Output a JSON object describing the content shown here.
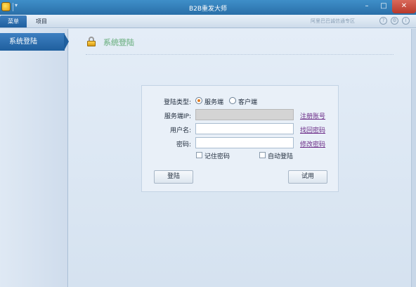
{
  "window": {
    "title": "B2B重发大师",
    "min_label": "–",
    "max_label": "□",
    "close_label": "✕"
  },
  "ribbon": {
    "tabs": [
      {
        "label": "菜单",
        "active": true
      },
      {
        "label": "项目",
        "active": false
      }
    ],
    "right_text": "阿里巴巴诚信通专区"
  },
  "sidebar": {
    "items": [
      {
        "label": "系统登陆",
        "active": true
      }
    ]
  },
  "page": {
    "title": "系统登陆"
  },
  "login": {
    "login_type_label": "登陆类型:",
    "login_type_options": [
      {
        "label": "服务端",
        "selected": true
      },
      {
        "label": "客户端",
        "selected": false
      }
    ],
    "server_ip_label": "服务端IP:",
    "server_ip_value": "",
    "username_label": "用户名:",
    "username_value": "",
    "password_label": "密码:",
    "password_value": "",
    "register_link": "注册账号",
    "find_password_link": "找回密码",
    "change_password_link": "修改密码",
    "remember_password_label": "记住密码",
    "remember_password_checked": false,
    "auto_login_label": "自动登陆",
    "auto_login_checked": false,
    "login_button": "登陆",
    "trial_button": "试用"
  },
  "colors": {
    "titlebar": "#2a6fa8",
    "active_tab": "#1f5f9e",
    "link": "#6a2a86",
    "radio_selected": "#e07a20"
  }
}
